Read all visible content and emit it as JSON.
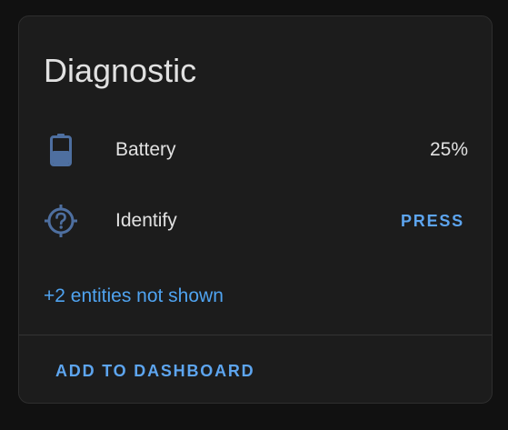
{
  "card": {
    "title": "Diagnostic"
  },
  "entities": [
    {
      "label": "Battery",
      "value": "25%",
      "icon": "battery-icon",
      "level": 0.25
    },
    {
      "label": "Identify",
      "action_label": "PRESS",
      "icon": "identify-icon"
    }
  ],
  "more_entities_text": "+2 entities not shown",
  "footer": {
    "add_label": "ADD TO DASHBOARD"
  },
  "colors": {
    "accent": "#4fa3f0",
    "icon": "#4e6fa0",
    "text": "#e1e1e1",
    "card_bg": "#1c1c1c",
    "page_bg": "#111111"
  }
}
